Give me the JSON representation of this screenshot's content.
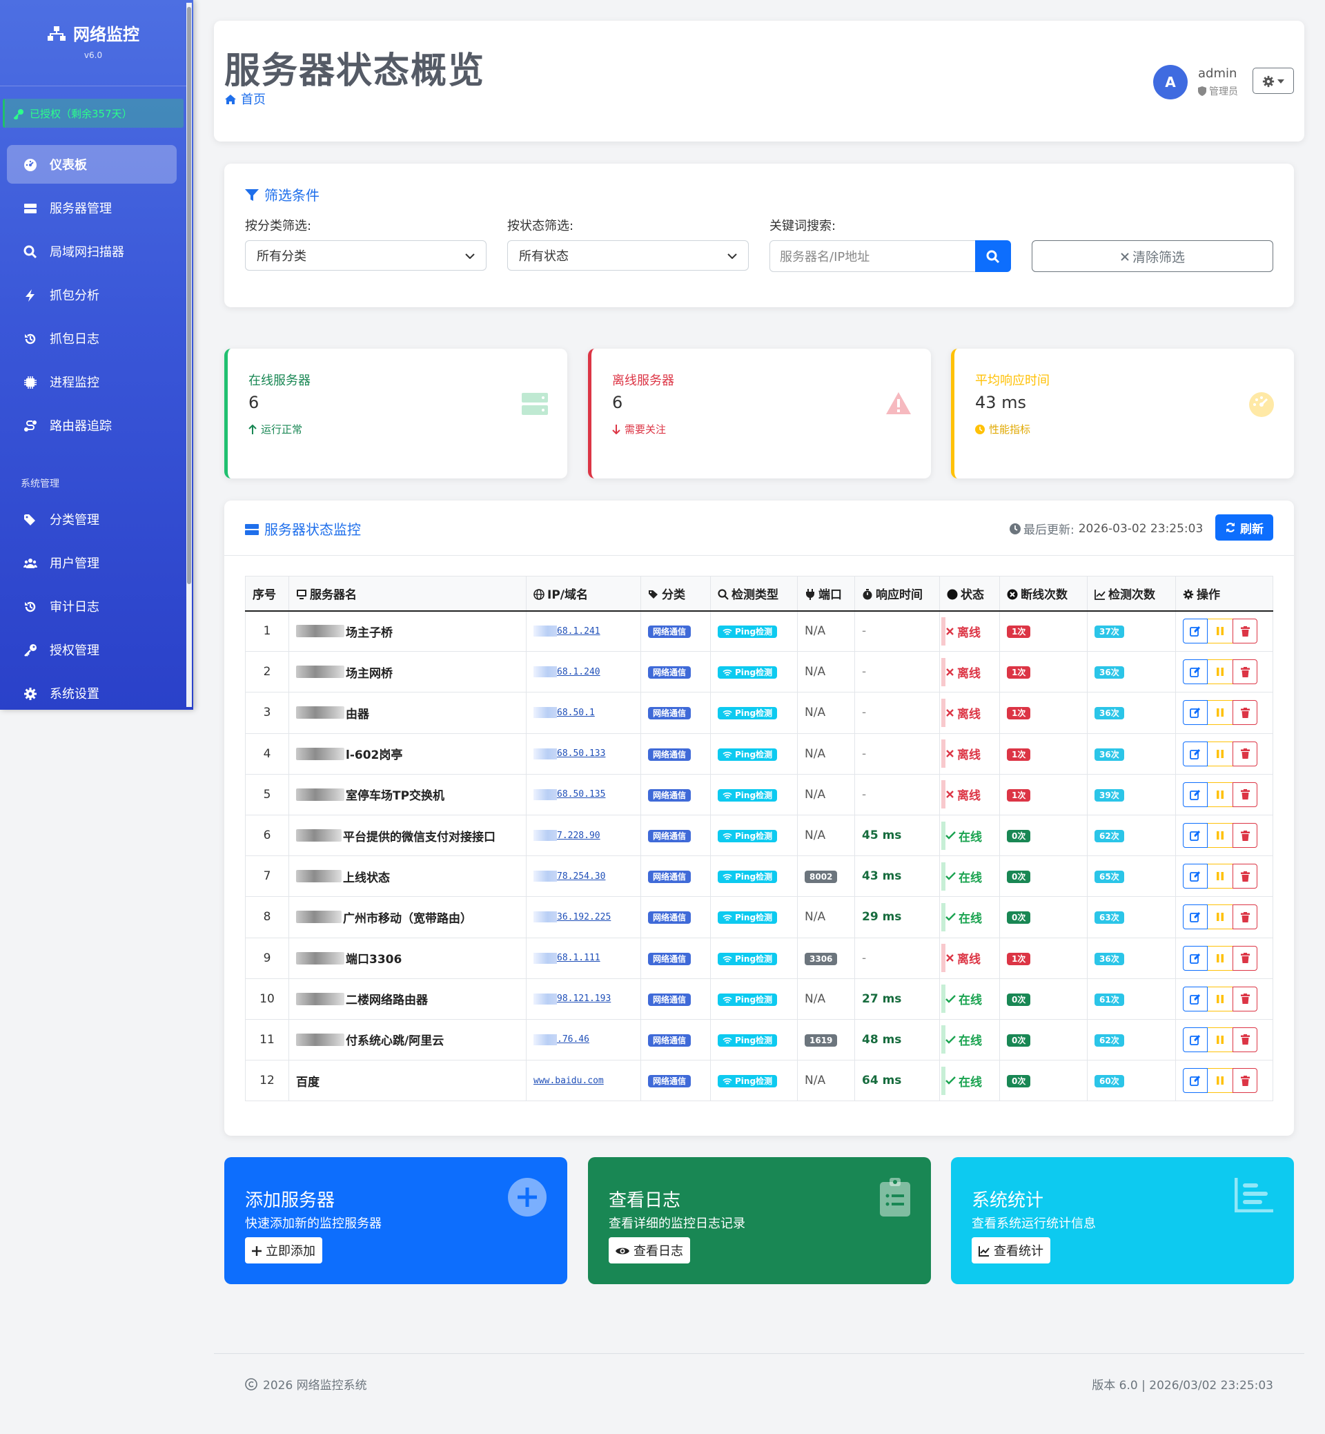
{
  "sidebar": {
    "brand": "网络监控",
    "version": "v6.0",
    "license": "已授权（剩余357天）",
    "items": [
      {
        "label": "仪表板",
        "icon": "dashboard-icon",
        "active": true
      },
      {
        "label": "服务器管理",
        "icon": "server-icon"
      },
      {
        "label": "局域网扫描器",
        "icon": "search-icon"
      },
      {
        "label": "抓包分析",
        "icon": "bolt-icon"
      },
      {
        "label": "抓包日志",
        "icon": "history-icon"
      },
      {
        "label": "进程监控",
        "icon": "cpu-icon"
      },
      {
        "label": "路由器追踪",
        "icon": "route-icon"
      }
    ],
    "section_label": "系统管理",
    "admin_items": [
      {
        "label": "分类管理",
        "icon": "tags-icon"
      },
      {
        "label": "用户管理",
        "icon": "users-icon"
      },
      {
        "label": "审计日志",
        "icon": "history-icon"
      },
      {
        "label": "授权管理",
        "icon": "key-icon"
      },
      {
        "label": "系统设置",
        "icon": "gear-icon"
      }
    ]
  },
  "header": {
    "title": "服务器状态概览",
    "breadcrumb": "首页",
    "user": {
      "avatar": "A",
      "name": "admin",
      "role": "管理员"
    }
  },
  "filters": {
    "title": "筛选条件",
    "category_label": "按分类筛选:",
    "category_value": "所有分类",
    "status_label": "按状态筛选:",
    "status_value": "所有状态",
    "keyword_label": "关键词搜索:",
    "keyword_placeholder": "服务器名/IP地址",
    "clear_label": "清除筛选"
  },
  "stats": [
    {
      "label": "在线服务器",
      "value": "6",
      "sub": "运行正常",
      "color": "#20c070"
    },
    {
      "label": "离线服务器",
      "value": "6",
      "sub": "需要关注",
      "color": "#dc3545"
    },
    {
      "label": "平均响应时间",
      "value": "43 ms",
      "sub": "性能指标",
      "color": "#ffc107"
    }
  ],
  "monitor": {
    "title": "服务器状态监控",
    "updated_label": "最后更新:",
    "updated_time": "2026-03-02 23:25:03",
    "refresh_label": "刷新",
    "columns": [
      "序号",
      "服务器名",
      "IP/域名",
      "分类",
      "检测类型",
      "端口",
      "响应时间",
      "状态",
      "断线次数",
      "检测次数",
      "操作"
    ],
    "rows": [
      {
        "no": "1",
        "name": "场主子桥",
        "blur": 70,
        "ip": "68.1.241",
        "category": "网络通信",
        "check": "Ping检测",
        "port": "N/A",
        "resp": "-",
        "status": "离线",
        "online": false,
        "drops": "1次",
        "checks": "37次"
      },
      {
        "no": "2",
        "name": "场主网桥",
        "blur": 70,
        "ip": "68.1.240",
        "category": "网络通信",
        "check": "Ping检测",
        "port": "N/A",
        "resp": "-",
        "status": "离线",
        "online": false,
        "drops": "1次",
        "checks": "36次"
      },
      {
        "no": "3",
        "name": "由器",
        "blur": 70,
        "ip": "68.50.1",
        "category": "网络通信",
        "check": "Ping检测",
        "port": "N/A",
        "resp": "-",
        "status": "离线",
        "online": false,
        "drops": "1次",
        "checks": "36次"
      },
      {
        "no": "4",
        "name": "l-602岗亭",
        "blur": 70,
        "ip": "68.50.133",
        "category": "网络通信",
        "check": "Ping检测",
        "port": "N/A",
        "resp": "-",
        "status": "离线",
        "online": false,
        "drops": "1次",
        "checks": "36次"
      },
      {
        "no": "5",
        "name": "室停车场TP交换机",
        "blur": 70,
        "ip": "68.50.135",
        "category": "网络通信",
        "check": "Ping检测",
        "port": "N/A",
        "resp": "-",
        "status": "离线",
        "online": false,
        "drops": "1次",
        "checks": "39次"
      },
      {
        "no": "6",
        "name": "平台提供的微信支付对接接口",
        "blur": 66,
        "ip": "7.228.90",
        "category": "网络通信",
        "check": "Ping检测",
        "port": "N/A",
        "resp": "45 ms",
        "status": "在线",
        "online": true,
        "drops": "0次",
        "checks": "62次"
      },
      {
        "no": "7",
        "name": "上线状态",
        "blur": 66,
        "ip": "78.254.30",
        "category": "网络通信",
        "check": "Ping检测",
        "port": "8002",
        "resp": "43 ms",
        "status": "在线",
        "online": true,
        "drops": "0次",
        "checks": "65次"
      },
      {
        "no": "8",
        "name": "广州市移动（宽带路由）",
        "blur": 66,
        "ip": "36.192.225",
        "category": "网络通信",
        "check": "Ping检测",
        "port": "N/A",
        "resp": "29 ms",
        "status": "在线",
        "online": true,
        "drops": "0次",
        "checks": "63次"
      },
      {
        "no": "9",
        "name": "端口3306",
        "blur": 70,
        "ip": "68.1.111",
        "category": "网络通信",
        "check": "Ping检测",
        "port": "3306",
        "resp": "-",
        "status": "离线",
        "online": false,
        "drops": "1次",
        "checks": "36次"
      },
      {
        "no": "10",
        "name": "二楼网络路由器",
        "blur": 70,
        "ip": "98.121.193",
        "category": "网络通信",
        "check": "Ping检测",
        "port": "N/A",
        "resp": "27 ms",
        "status": "在线",
        "online": true,
        "drops": "0次",
        "checks": "61次"
      },
      {
        "no": "11",
        "name": "付系统心跳/阿里云",
        "blur": 70,
        "ip": ".76.46",
        "category": "网络通信",
        "check": "Ping检测",
        "port": "1619",
        "resp": "48 ms",
        "status": "在线",
        "online": true,
        "drops": "0次",
        "checks": "62次"
      },
      {
        "no": "12",
        "name": "百度",
        "blur": 0,
        "ip": "www.baidu.com",
        "category": "网络通信",
        "check": "Ping检测",
        "port": "N/A",
        "resp": "64 ms",
        "status": "在线",
        "online": true,
        "drops": "0次",
        "checks": "60次"
      }
    ]
  },
  "actions": [
    {
      "title": "添加服务器",
      "desc": "快速添加新的监控服务器",
      "button": "立即添加",
      "color": "#0d6efd"
    },
    {
      "title": "查看日志",
      "desc": "查看详细的监控日志记录",
      "button": "查看日志",
      "color": "#198754"
    },
    {
      "title": "系统统计",
      "desc": "查看系统运行统计信息",
      "button": "查看统计",
      "color": "#0dcaf0"
    }
  ],
  "footer": {
    "copyright": "2026 网络监控系统",
    "version": "版本 6.0 | 2026/03/02 23:25:03"
  }
}
